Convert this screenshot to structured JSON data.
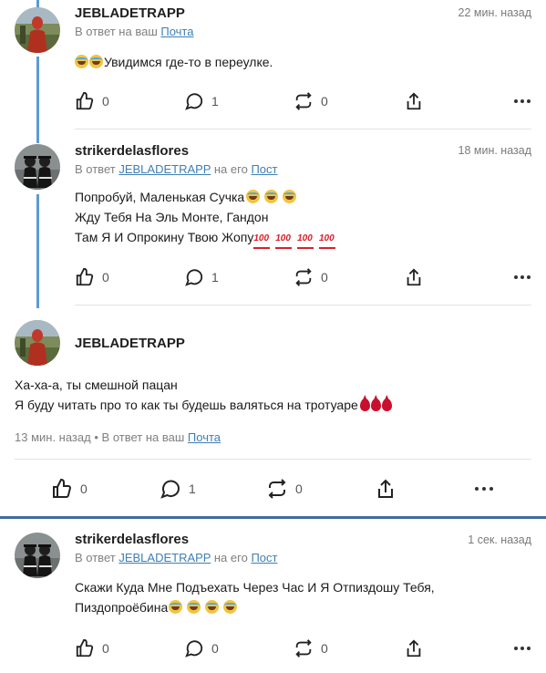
{
  "posts": [
    {
      "username": "JEBLADETRAPP",
      "time": "22 мин. назад",
      "reply_prefix": "В ответ на ваш",
      "reply_link": "Почта",
      "lines": [
        "Увидимся где-то в переулке."
      ],
      "likes": "0",
      "comments": "1",
      "reposts": "0"
    },
    {
      "username": "strikerdelasflores",
      "time": "18 мин. назад",
      "reply_prefix": "В ответ",
      "reply_user": "JEBLADETRAPP",
      "reply_mid": "на его",
      "reply_link": "Пост",
      "lines": [
        "Попробуй, Маленькая Сучка",
        "Жду Тебя На Эль Монте, Гандон",
        "Там Я И Опрокину Твою Жопу"
      ],
      "likes": "0",
      "comments": "1",
      "reposts": "0"
    },
    {
      "username": "JEBLADETRAPP",
      "lines": [
        "Ха-ха-а, ты смешной пацан",
        "Я буду читать про то как ты будешь валяться на тротуаре"
      ],
      "meta_time": "13 мин. назад",
      "meta_sep": "•",
      "reply_prefix": "В ответ на ваш",
      "reply_link": "Почта",
      "likes": "0",
      "comments": "1",
      "reposts": "0"
    },
    {
      "username": "strikerdelasflores",
      "time": "1 сек. назад",
      "reply_prefix": "В ответ",
      "reply_user": "JEBLADETRAPP",
      "reply_mid": "на его",
      "reply_link": "Пост",
      "lines": [
        "Скажи Куда Мне Подъехать Через Час И Я Отпиздошу Тебя,",
        "Пиздопроёбина"
      ],
      "likes": "0",
      "comments": "0",
      "reposts": "0"
    }
  ],
  "icons": [
    "like-icon",
    "comment-icon",
    "repost-icon",
    "share-icon",
    "more-icon"
  ],
  "colors": {
    "thread_line": "#5b9bd5",
    "link": "#3d7fb5",
    "separator_bar": "#3d6e9c"
  }
}
